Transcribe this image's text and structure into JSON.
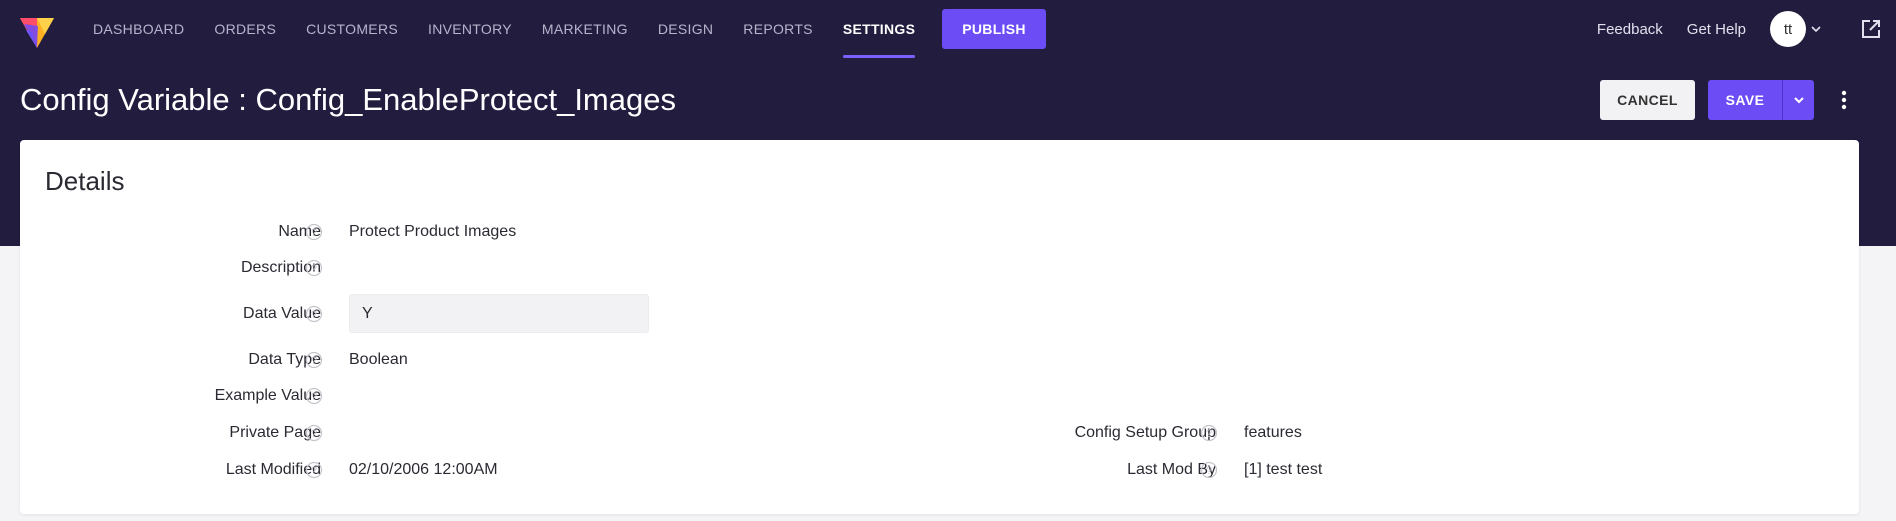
{
  "nav": {
    "items": [
      "DASHBOARD",
      "ORDERS",
      "CUSTOMERS",
      "INVENTORY",
      "MARKETING",
      "DESIGN",
      "REPORTS",
      "SETTINGS"
    ],
    "active": "SETTINGS",
    "publish_label": "PUBLISH",
    "feedback_label": "Feedback",
    "help_label": "Get Help",
    "avatar_initials": "tt"
  },
  "header": {
    "title": "Config Variable : Config_EnableProtect_Images",
    "cancel_label": "CANCEL",
    "save_label": "SAVE"
  },
  "details": {
    "title": "Details",
    "name_label": "Name",
    "name_value": "Protect Product Images",
    "description_label": "Description",
    "data_value_label": "Data Value",
    "data_value": "Y",
    "data_type_label": "Data Type",
    "data_type_value": "Boolean",
    "example_value_label": "Example Value",
    "private_page_label": "Private Page",
    "last_modified_label": "Last Modified",
    "last_modified_value": "02/10/2006 12:00AM",
    "config_setup_group_label": "Config Setup Group",
    "config_setup_group_value": "features",
    "last_mod_by_label": "Last Mod By",
    "last_mod_by_value": "[1] test test"
  },
  "colors": {
    "header_bg": "#221c3f",
    "accent": "#6c4cf5",
    "page_bg": "#f4f4f6"
  }
}
